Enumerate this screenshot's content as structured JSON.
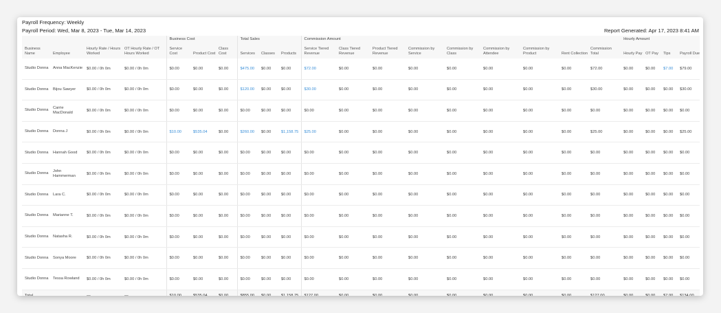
{
  "header": {
    "frequency": "Payroll Frequency: Weekly",
    "period": "Payroll Period: Wed, Mar 8, 2023 - Tue, Mar 14, 2023",
    "generated": "Report Generated: Apr 17, 2023 8:41 AM"
  },
  "groups": {
    "business_cost": "Business Cost",
    "total_sales": "Total Sales",
    "commission_amount": "Commission Amount",
    "hourly_amount": "Hourly Amount"
  },
  "columns": [
    "Business Name",
    "Employee",
    "Hourly Rate / Hours Worked",
    "OT Hourly Rate / OT Hours Worked",
    "Service Cost",
    "Product Cost",
    "Class Cost",
    "Services",
    "Classes",
    "Products",
    "Service Tiered Revenue",
    "Class Tiered Revenue",
    "Product Tiered Revenue",
    "Commission by Service",
    "Commission by Class",
    "Commission by Attendee",
    "Commission by Product",
    "Rent Collection",
    "Commission Total",
    "Hourly Pay",
    "OT Pay",
    "Tips",
    "Payroll Due"
  ],
  "rows": [
    [
      "Studio Donna",
      "Anna MacKenzie",
      "$0.00 / 0h 0m",
      "$0.00 / 0h 0m",
      "$0.00",
      "$0.00",
      "$0.00",
      "$475.00",
      "$0.00",
      "$0.00",
      "$72.00",
      "$0.00",
      "$0.00",
      "$0.00",
      "$0.00",
      "$0.00",
      "$0.00",
      "$0.00",
      "$72.00",
      "$0.00",
      "$0.00",
      "$7.00",
      "$79.00"
    ],
    [
      "Studio Donna",
      "Bijou Sawyer",
      "$0.00 / 0h 0m",
      "$0.00 / 0h 0m",
      "$0.00",
      "$0.00",
      "$0.00",
      "$120.00",
      "$0.00",
      "$0.00",
      "$30.00",
      "$0.00",
      "$0.00",
      "$0.00",
      "$0.00",
      "$0.00",
      "$0.00",
      "$0.00",
      "$30.00",
      "$0.00",
      "$0.00",
      "$0.00",
      "$30.00"
    ],
    [
      "Studio Donna",
      "Carrie MacDonald",
      "$0.00 / 0h 0m",
      "$0.00 / 0h 0m",
      "$0.00",
      "$0.00",
      "$0.00",
      "$0.00",
      "$0.00",
      "$0.00",
      "$0.00",
      "$0.00",
      "$0.00",
      "$0.00",
      "$0.00",
      "$0.00",
      "$0.00",
      "$0.00",
      "$0.00",
      "$0.00",
      "$0.00",
      "$0.00",
      "$0.00"
    ],
    [
      "Studio Donna",
      "Donna J",
      "$0.00 / 0h 0m",
      "$0.00 / 0h 0m",
      "$10.00",
      "$535.04",
      "$0.00",
      "$260.00",
      "$0.00",
      "$1,158.75",
      "$25.00",
      "$0.00",
      "$0.00",
      "$0.00",
      "$0.00",
      "$0.00",
      "$0.00",
      "$0.00",
      "$25.00",
      "$0.00",
      "$0.00",
      "$0.00",
      "$25.00"
    ],
    [
      "Studio Donna",
      "Hannah Good",
      "$0.00 / 0h 0m",
      "$0.00 / 0h 0m",
      "$0.00",
      "$0.00",
      "$0.00",
      "$0.00",
      "$0.00",
      "$0.00",
      "$0.00",
      "$0.00",
      "$0.00",
      "$0.00",
      "$0.00",
      "$0.00",
      "$0.00",
      "$0.00",
      "$0.00",
      "$0.00",
      "$0.00",
      "$0.00",
      "$0.00"
    ],
    [
      "Studio Donna",
      "John Hammerman",
      "$0.00 / 0h 0m",
      "$0.00 / 0h 0m",
      "$0.00",
      "$0.00",
      "$0.00",
      "$0.00",
      "$0.00",
      "$0.00",
      "$0.00",
      "$0.00",
      "$0.00",
      "$0.00",
      "$0.00",
      "$0.00",
      "$0.00",
      "$0.00",
      "$0.00",
      "$0.00",
      "$0.00",
      "$0.00",
      "$0.00"
    ],
    [
      "Studio Donna",
      "Lara C.",
      "$0.00 / 0h 0m",
      "$0.00 / 0h 0m",
      "$0.00",
      "$0.00",
      "$0.00",
      "$0.00",
      "$0.00",
      "$0.00",
      "$0.00",
      "$0.00",
      "$0.00",
      "$0.00",
      "$0.00",
      "$0.00",
      "$0.00",
      "$0.00",
      "$0.00",
      "$0.00",
      "$0.00",
      "$0.00",
      "$0.00"
    ],
    [
      "Studio Donna",
      "Marianne T.",
      "$0.00 / 0h 0m",
      "$0.00 / 0h 0m",
      "$0.00",
      "$0.00",
      "$0.00",
      "$0.00",
      "$0.00",
      "$0.00",
      "$0.00",
      "$0.00",
      "$0.00",
      "$0.00",
      "$0.00",
      "$0.00",
      "$0.00",
      "$0.00",
      "$0.00",
      "$0.00",
      "$0.00",
      "$0.00",
      "$0.00"
    ],
    [
      "Studio Donna",
      "Natasha R.",
      "$0.00 / 0h 0m",
      "$0.00 / 0h 0m",
      "$0.00",
      "$0.00",
      "$0.00",
      "$0.00",
      "$0.00",
      "$0.00",
      "$0.00",
      "$0.00",
      "$0.00",
      "$0.00",
      "$0.00",
      "$0.00",
      "$0.00",
      "$0.00",
      "$0.00",
      "$0.00",
      "$0.00",
      "$0.00",
      "$0.00"
    ],
    [
      "Studio Donna",
      "Sonya Moore",
      "$0.00 / 0h 0m",
      "$0.00 / 0h 0m",
      "$0.00",
      "$0.00",
      "$0.00",
      "$0.00",
      "$0.00",
      "$0.00",
      "$0.00",
      "$0.00",
      "$0.00",
      "$0.00",
      "$0.00",
      "$0.00",
      "$0.00",
      "$0.00",
      "$0.00",
      "$0.00",
      "$0.00",
      "$0.00",
      "$0.00"
    ],
    [
      "Studio Donna",
      "Tessa Rowland",
      "$0.00 / 0h 0m",
      "$0.00 / 0h 0m",
      "$0.00",
      "$0.00",
      "$0.00",
      "$0.00",
      "$0.00",
      "$0.00",
      "$0.00",
      "$0.00",
      "$0.00",
      "$0.00",
      "$0.00",
      "$0.00",
      "$0.00",
      "$0.00",
      "$0.00",
      "$0.00",
      "$0.00",
      "$0.00",
      "$0.00"
    ]
  ],
  "total": [
    "Total",
    "",
    "—",
    "—",
    "$10.00",
    "$535.04",
    "$0.00",
    "$855.00",
    "$0.00",
    "$1,158.75",
    "$127.00",
    "$0.00",
    "$0.00",
    "$0.00",
    "$0.00",
    "$0.00",
    "$0.00",
    "$0.00",
    "$127.00",
    "$0.00",
    "$0.00",
    "$7.00",
    "$134.00"
  ],
  "link_color": "#3a8fd8"
}
